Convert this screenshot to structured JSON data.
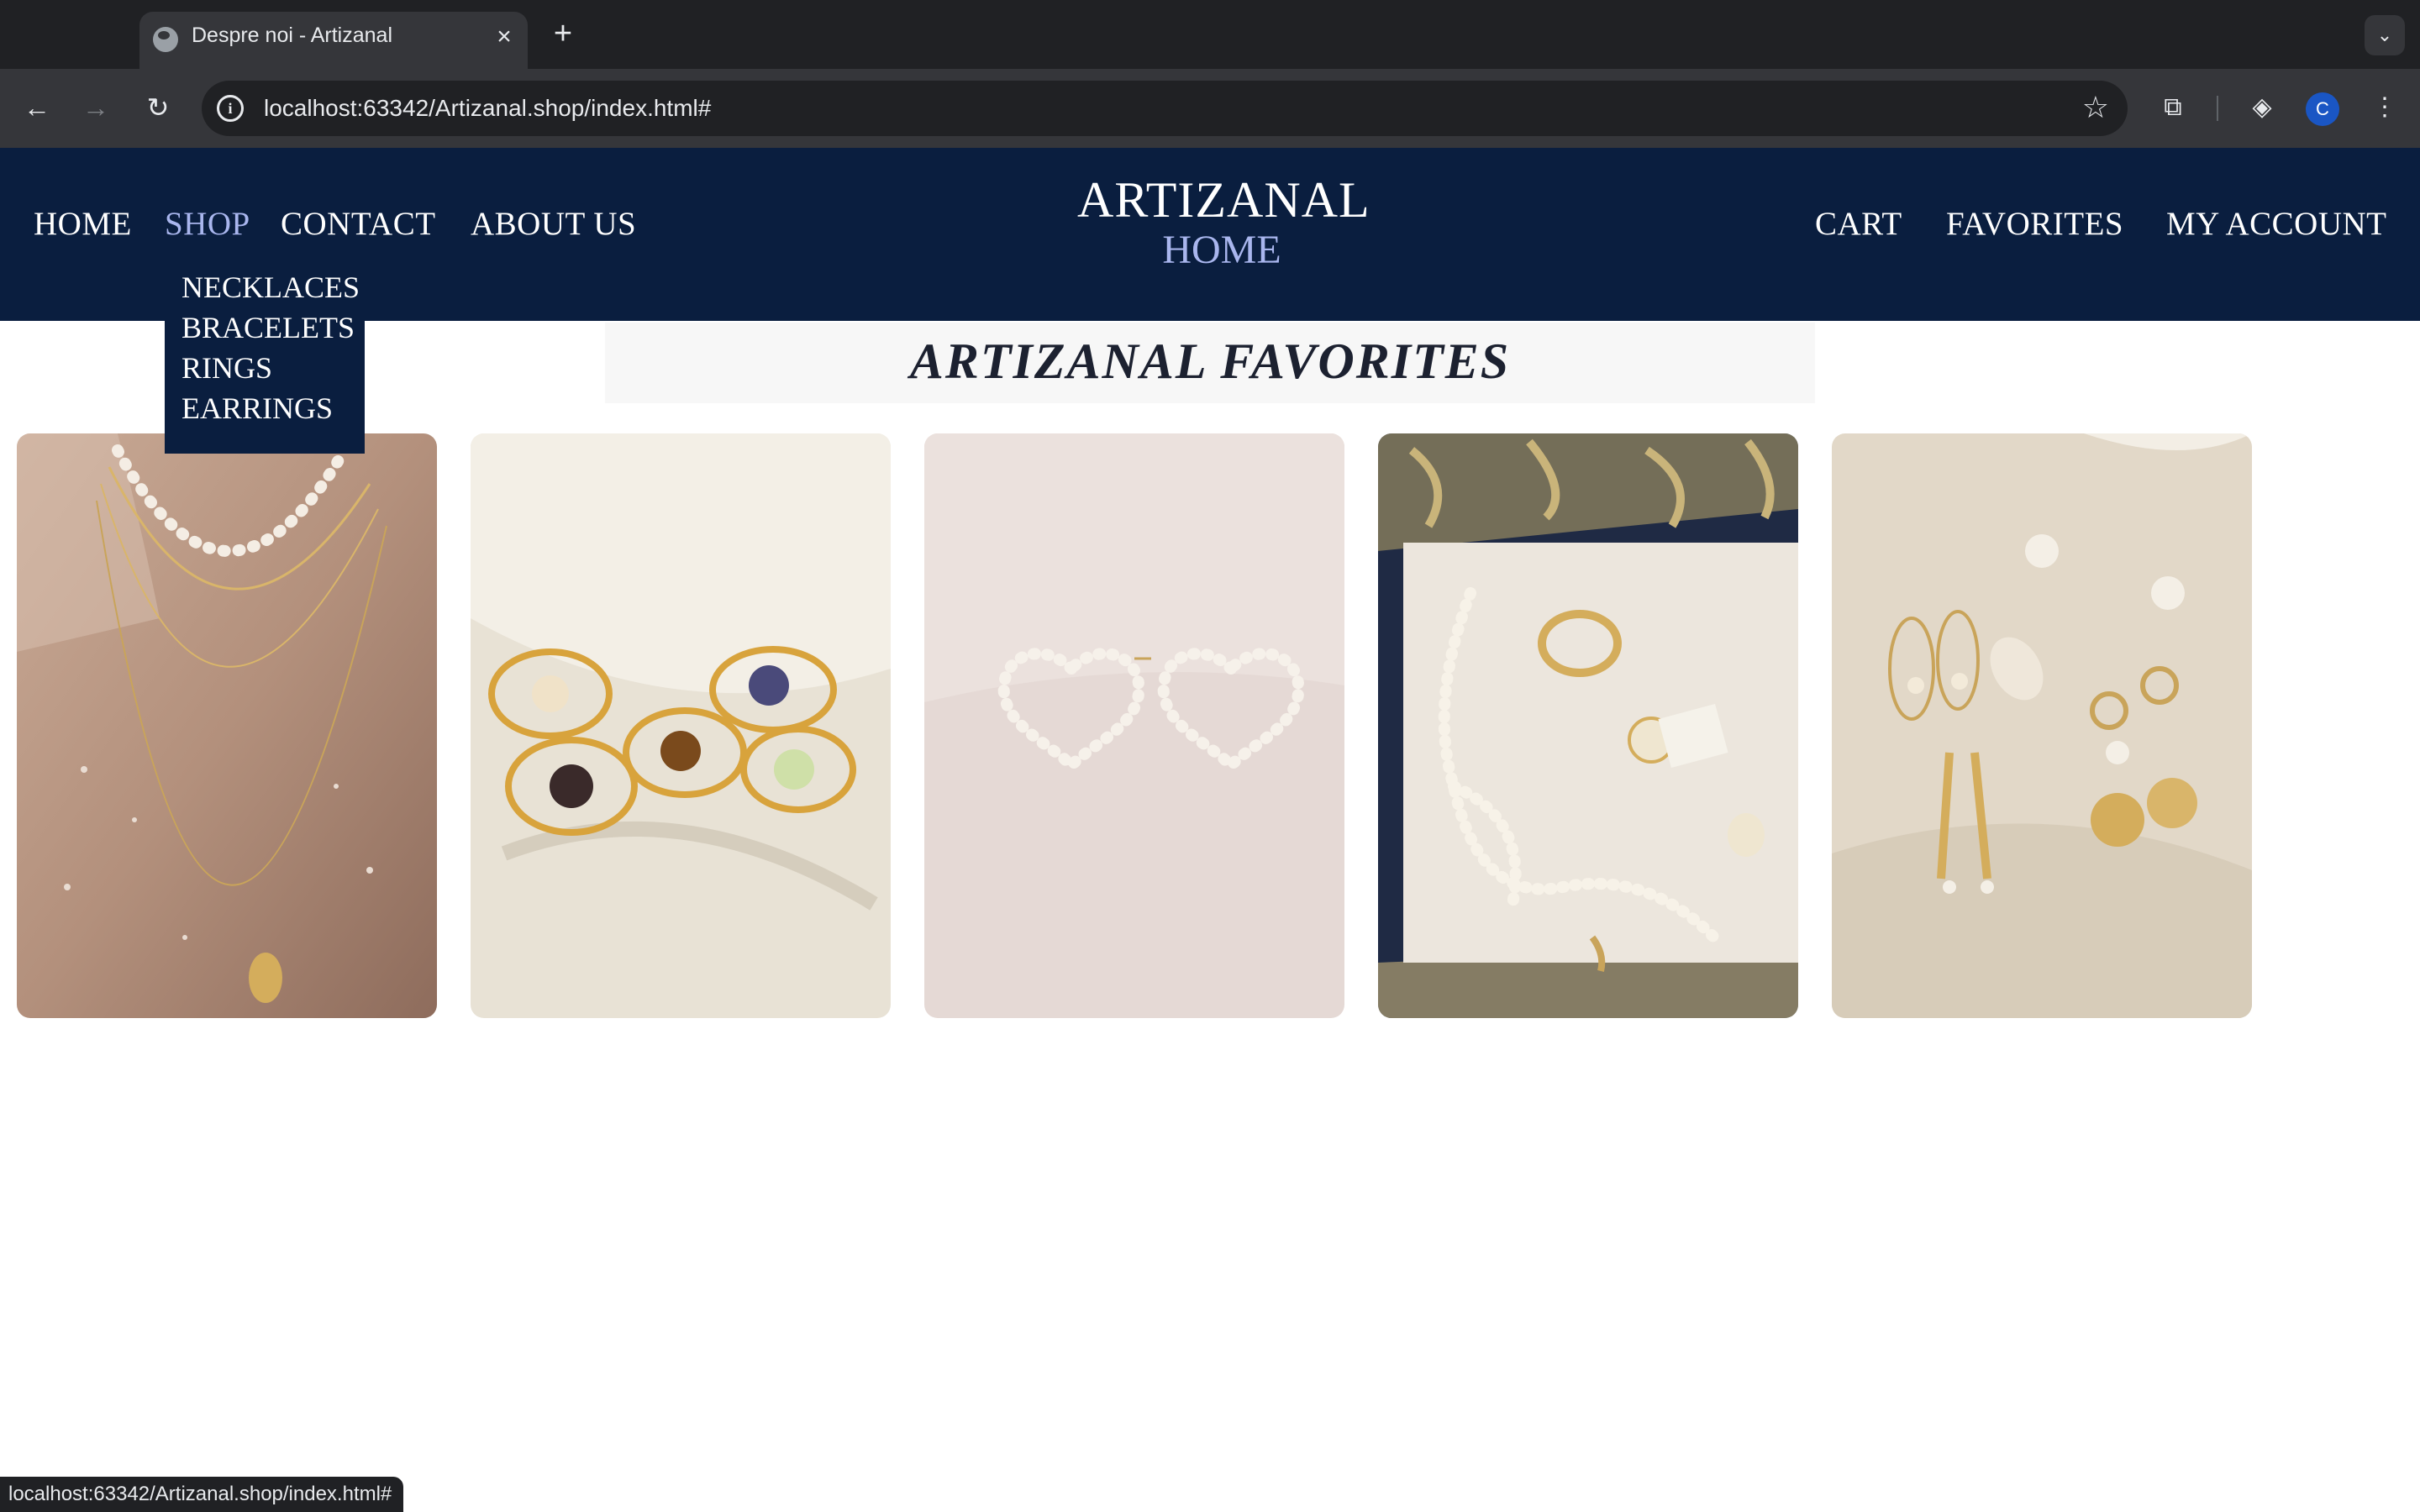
{
  "browser": {
    "tab_title": "Despre noi - Artizanal",
    "url": "localhost:63342/Artizanal.shop/index.html#",
    "profile_initial": "C",
    "status_url": "localhost:63342/Artizanal.shop/index.html#"
  },
  "header": {
    "nav_left": [
      "HOME",
      "SHOP",
      "CONTACT",
      "ABOUT US"
    ],
    "brand": "ARTIZANAL",
    "brand_sub": "HOME",
    "nav_right": [
      "CART",
      "FAVORITES",
      "MY ACCOUNT"
    ],
    "active_item": "SHOP",
    "colors": {
      "bar": "#0a1e3f",
      "text": "#ffffff",
      "active": "#a9b6ee"
    }
  },
  "shop_menu": [
    "NECKLACES",
    "BRACELETS",
    "RINGS",
    "EARRINGS"
  ],
  "favorites": {
    "title": "ARTIZANAL FAVORITES",
    "products": [
      {
        "image": "layered pearl and gold necklaces"
      },
      {
        "image": "gold wire-wrapped gemstone rings"
      },
      {
        "image": "pearl heart hoop earrings"
      },
      {
        "image": "pearl necklace, rings and earrings on floral tray"
      },
      {
        "image": "gold and pearl earrings with seashells"
      }
    ]
  },
  "icons": [
    "globe-icon",
    "close-icon",
    "plus-icon",
    "chevron-down-icon",
    "back-arrow-icon",
    "forward-arrow-icon",
    "reload-icon",
    "site-info-icon",
    "star-icon",
    "extensions-icon",
    "performance-icon",
    "kebab-menu-icon"
  ]
}
